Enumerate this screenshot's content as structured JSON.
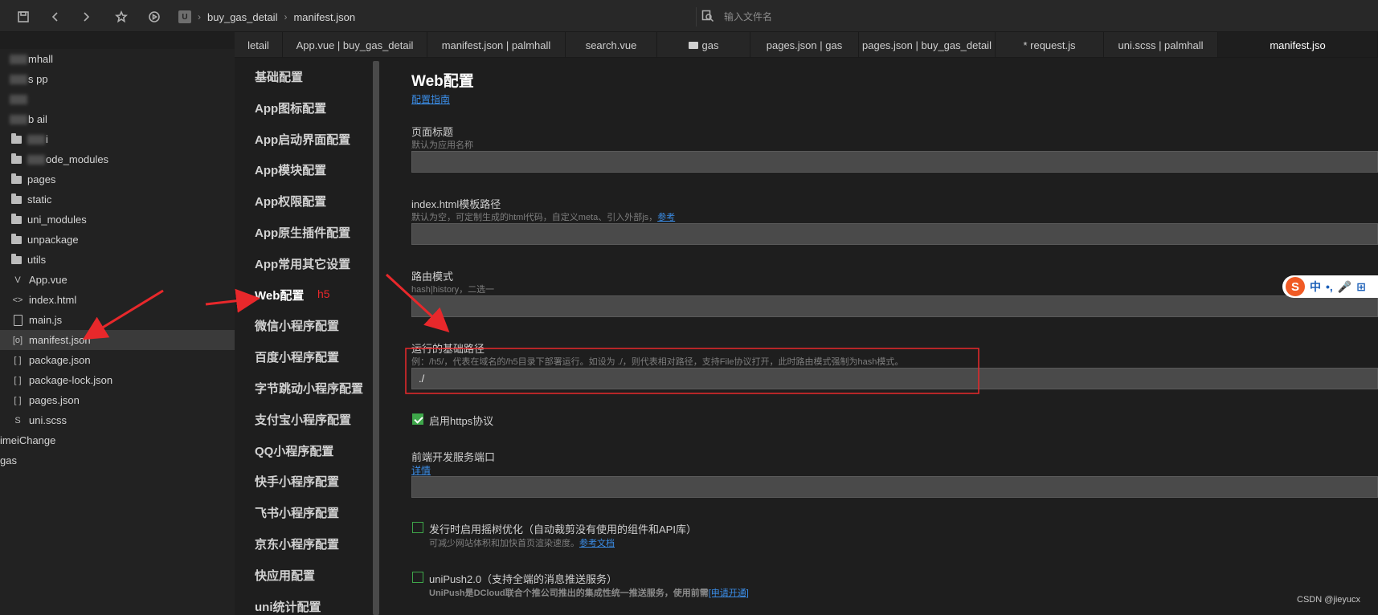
{
  "toolbar": {
    "icons": [
      "save-icon",
      "back-icon",
      "forward-icon",
      "star-icon",
      "run-icon"
    ],
    "breadcrumb": {
      "logo": "U",
      "project": "buy_gas_detail",
      "file": "manifest.json"
    },
    "search": {
      "placeholder": "输入文件名"
    }
  },
  "file_tree": {
    "items": [
      {
        "label": "mhall",
        "type": "project",
        "blurred_prefix": true
      },
      {
        "label": "s  pp",
        "type": "project",
        "blurred_prefix": true
      },
      {
        "label": "",
        "type": "project",
        "blurred_prefix": true
      },
      {
        "label": "b   ail",
        "type": "project",
        "blurred_prefix": true
      },
      {
        "label": "i",
        "type": "folder",
        "blurred_prefix": true
      },
      {
        "label": "ode_modules",
        "type": "folder",
        "blurred_prefix": true
      },
      {
        "label": "pages",
        "type": "folder"
      },
      {
        "label": "static",
        "type": "folder"
      },
      {
        "label": "uni_modules",
        "type": "folder"
      },
      {
        "label": "unpackage",
        "type": "folder"
      },
      {
        "label": "utils",
        "type": "folder"
      },
      {
        "label": "App.vue",
        "type": "file",
        "icon": "V"
      },
      {
        "label": "index.html",
        "type": "file",
        "icon": "<>"
      },
      {
        "label": "main.js",
        "type": "file"
      },
      {
        "label": "manifest.json",
        "type": "file",
        "icon": "[o]",
        "active": true
      },
      {
        "label": "package.json",
        "type": "file",
        "icon": "[ ]"
      },
      {
        "label": "package-lock.json",
        "type": "file",
        "icon": "[ ]"
      },
      {
        "label": "pages.json",
        "type": "file",
        "icon": "[ ]"
      },
      {
        "label": "uni.scss",
        "type": "file",
        "icon": "S"
      },
      {
        "label": "imeiChange",
        "type": "project"
      },
      {
        "label": "gas",
        "type": "project"
      }
    ]
  },
  "tabs": [
    {
      "label": "letail"
    },
    {
      "label": "App.vue | buy_gas_detail"
    },
    {
      "label": "manifest.json | palmhall"
    },
    {
      "label": "search.vue"
    },
    {
      "label": "gas",
      "folder": true
    },
    {
      "label": "pages.json | gas"
    },
    {
      "label": "pages.json | buy_gas_detail"
    },
    {
      "label": "* request.js"
    },
    {
      "label": "uni.scss | palmhall"
    },
    {
      "label": "manifest.jso",
      "active": true
    }
  ],
  "settings_nav": {
    "items": [
      "基础配置",
      "App图标配置",
      "App启动界面配置",
      "App模块配置",
      "App权限配置",
      "App原生插件配置",
      "App常用其它设置",
      "Web配置",
      "微信小程序配置",
      "百度小程序配置",
      "字节跳动小程序配置",
      "支付宝小程序配置",
      "QQ小程序配置",
      "快手小程序配置",
      "飞书小程序配置",
      "京东小程序配置",
      "快应用配置",
      "uni统计配置"
    ],
    "active_index": 7
  },
  "web_config": {
    "title": "Web配置",
    "guide_link": "配置指南",
    "page_title": {
      "label": "页面标题",
      "hint": "默认为应用名称",
      "value": ""
    },
    "template_path": {
      "label": "index.html模板路径",
      "hint": "默认为空，可定制生成的html代码，自定义meta、引入外部js，",
      "hint_link": "参考",
      "value": ""
    },
    "router_mode": {
      "label": "路由模式",
      "hint": "hash|history，二选一",
      "value": ""
    },
    "base_path": {
      "label": "运行的基础路径",
      "hint": "例：/h5/，代表在域名的/h5目录下部署运行。如设为 ./，则代表相对路径，支持File协议打开，此时路由模式强制为hash模式。",
      "value": "./"
    },
    "https": {
      "label": "启用https协议",
      "checked": true
    },
    "dev_port": {
      "label": "前端开发服务端口",
      "link": "详情",
      "value": ""
    },
    "treeshake": {
      "label": "发行时启用摇树优化（自动裁剪没有使用的组件和API库）",
      "checked": false,
      "hint": "可减少网站体积和加快首页渲染速度。",
      "hint_link": "参考文档"
    },
    "unipush": {
      "label": "uniPush2.0（支持全端的消息推送服务）",
      "checked": false,
      "hint": "UniPush是DCloud联合个推公司推出的集成性统一推送服务，使用前需",
      "hint_link": "[申请开通]"
    }
  },
  "annotation": {
    "note": "h5",
    "color": "#e8282b"
  },
  "ime": {
    "logo": "S",
    "items": [
      "中",
      "•,",
      "🎤",
      "⊞"
    ]
  },
  "watermark": "CSDN @jieyucx",
  "colors": {
    "accent_link": "#3b8ee8",
    "checkbox_green": "#3ea74a",
    "annotation_red": "#e8282b"
  }
}
